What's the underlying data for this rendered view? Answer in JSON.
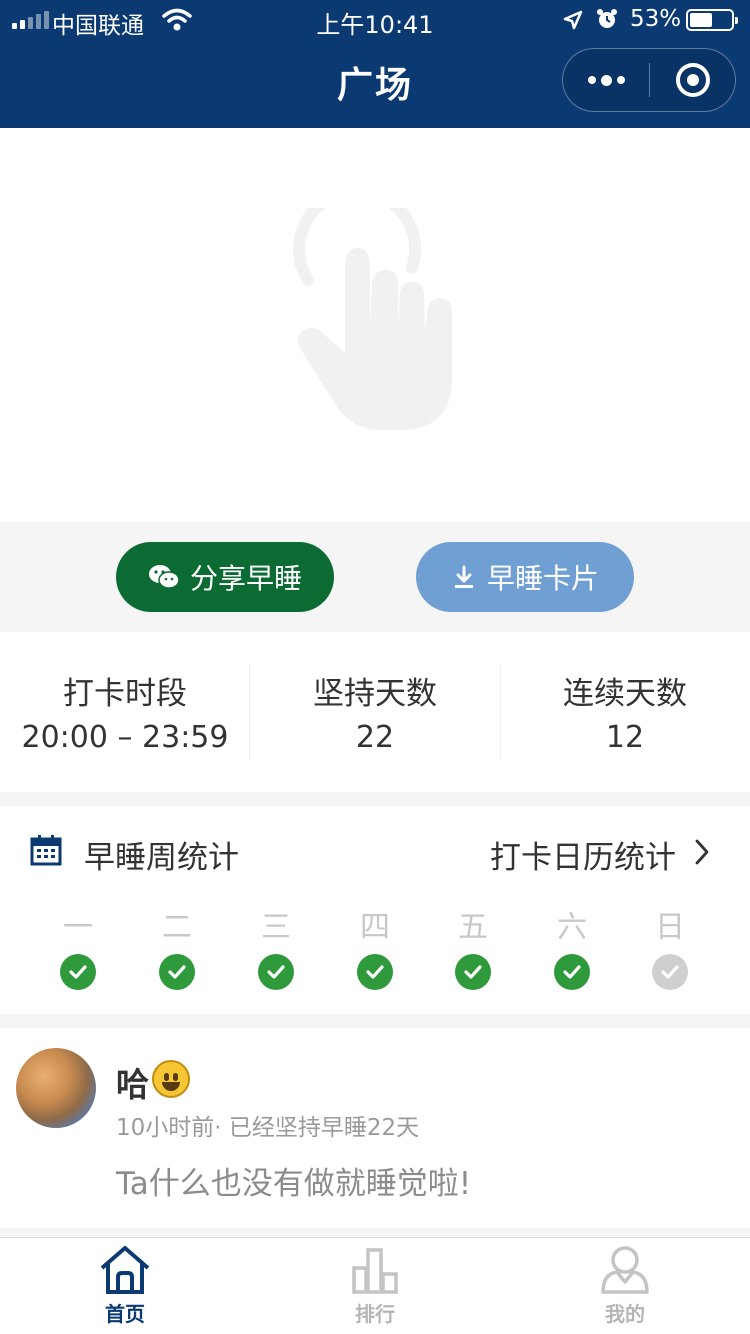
{
  "status_bar": {
    "carrier": "中国联通",
    "time": "上午10:41",
    "battery": "53%",
    "battery_level": 0.53,
    "icons": [
      "signal-icon",
      "wifi-icon",
      "location-arrow-icon",
      "alarm-icon",
      "battery-icon"
    ]
  },
  "header": {
    "title": "广场",
    "menu_icon": "more-dots-icon",
    "close_icon": "target-circle-icon",
    "color": "#0b3a73"
  },
  "hero": {
    "icon": "tap-hand-icon"
  },
  "actions": {
    "share_label": "分享早睡",
    "share_icon": "wechat-icon",
    "share_color": "#0b6b33",
    "card_label": "早睡卡片",
    "card_icon": "download-icon",
    "card_color": "#6f9fd3"
  },
  "stats": [
    {
      "label": "打卡时段",
      "value": "20:00 – 23:59"
    },
    {
      "label": "坚持天数",
      "value": "22"
    },
    {
      "label": "连续天数",
      "value": "12"
    }
  ],
  "week": {
    "title": "早睡周统计",
    "calendar_link": "打卡日历统计",
    "icon": "calendar-icon",
    "days": [
      {
        "label": "一",
        "checked": true
      },
      {
        "label": "二",
        "checked": true
      },
      {
        "label": "三",
        "checked": true
      },
      {
        "label": "四",
        "checked": true
      },
      {
        "label": "五",
        "checked": true
      },
      {
        "label": "六",
        "checked": true
      },
      {
        "label": "日",
        "checked": false
      }
    ],
    "check_color": "#2e9a3c"
  },
  "feed": {
    "name": "哈",
    "emoji": "grinning-face-emoji",
    "meta": "10小时前· 已经坚持早睡22天",
    "text": "Ta什么也没有做就睡觉啦!"
  },
  "tabbar": [
    {
      "label": "首页",
      "icon": "home-icon",
      "active": true
    },
    {
      "label": "排行",
      "icon": "ranking-bars-icon",
      "active": false
    },
    {
      "label": "我的",
      "icon": "user-icon",
      "active": false
    }
  ]
}
